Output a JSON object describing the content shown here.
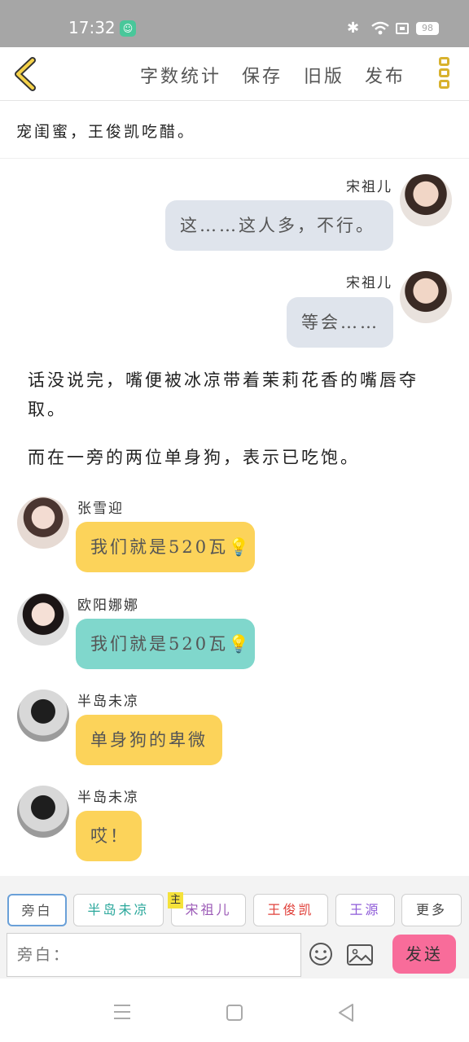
{
  "status_bar": {
    "time": "17:32",
    "battery": "98",
    "notification_icon": "app-notification-icon",
    "icons": [
      "bluetooth-icon",
      "wifi-icon",
      "sim-icon",
      "battery-icon"
    ]
  },
  "toolbar": {
    "word_count": "字数统计",
    "save": "保存",
    "old_version": "旧版",
    "publish": "发布"
  },
  "chapter": {
    "title": "宠闺蜜，王俊凯吃醋。"
  },
  "messages": [
    {
      "type": "right",
      "name": "宋祖儿",
      "text": "这……这人多，不行。"
    },
    {
      "type": "right",
      "name": "宋祖儿",
      "text": "等会……"
    },
    {
      "type": "narration",
      "text": "话没说完，嘴便被冰凉带着茉莉花香的嘴唇夺取。"
    },
    {
      "type": "narration",
      "text": "而在一旁的两位单身狗，表示已吃饱。"
    },
    {
      "type": "left",
      "name": "张雪迎",
      "text": "我们就是520瓦💡"
    },
    {
      "type": "left",
      "name": "欧阳娜娜",
      "text": "我们就是520瓦💡"
    },
    {
      "type": "left",
      "name": "半岛未凉",
      "text": "单身狗的卑微"
    },
    {
      "type": "left",
      "name": "半岛未凉",
      "text": "哎！"
    }
  ],
  "roles": [
    "旁白",
    "半岛未凉",
    "宋祖儿",
    "王俊凯",
    "王源",
    "更多"
  ],
  "main_tag": "主",
  "input": {
    "placeholder": "旁白："
  },
  "send_label": "发送",
  "colors": {
    "accent_yellow": "#fcd35a",
    "teal": "#80d7cc",
    "grey_bubble": "#dfe4ec",
    "send": "#f86c9a",
    "role_teal": "#2aa79b",
    "role_purple": "#9b59b6",
    "role_red": "#e0403a",
    "role_violet": "#8e5ad8"
  }
}
